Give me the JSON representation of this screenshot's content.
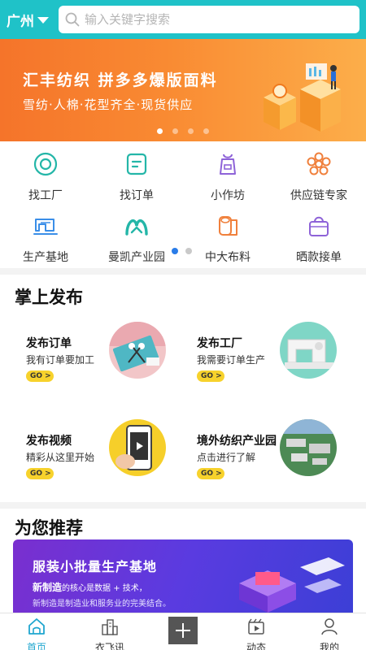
{
  "header": {
    "city": "广州",
    "search_placeholder": "输入关键字搜索"
  },
  "banner": {
    "title": "汇丰纺织  拼多多爆版面料",
    "subtitle": "雪纺·人棉·花型齐全·现货供应",
    "dots": 4,
    "active_dot": 0
  },
  "grid": [
    {
      "label": "找工厂",
      "icon": "factory-target-icon"
    },
    {
      "label": "找订单",
      "icon": "order-list-icon"
    },
    {
      "label": "小作坊",
      "icon": "apron-icon"
    },
    {
      "label": "供应链专家",
      "icon": "gear-flower-icon"
    },
    {
      "label": "生产基地",
      "icon": "sewing-machine-icon"
    },
    {
      "label": "曼凯产业园",
      "icon": "mk-logo-icon"
    },
    {
      "label": "中大布料",
      "icon": "fabric-roll-icon"
    },
    {
      "label": "晒款接单",
      "icon": "shopping-bag-icon"
    }
  ],
  "publish": {
    "title": "掌上发布",
    "cards": [
      {
        "title": "发布订单",
        "subtitle": "我有订单要加工",
        "go": "GO >"
      },
      {
        "title": "发布工厂",
        "subtitle": "我需要订单生产",
        "go": "GO >"
      },
      {
        "title": "发布视频",
        "subtitle": "精彩从这里开始",
        "go": "GO >"
      },
      {
        "title": "境外纺织产业园",
        "subtitle": "点击进行了解",
        "go": "GO >"
      }
    ]
  },
  "recommend": {
    "title": "为您推荐",
    "banner_title": "服装小批量生产基地",
    "banner_line1_bold": "新制造",
    "banner_line1_rest": "的核心是数据 + 技术，",
    "banner_line2": "新制造是制造业和服务业的完美结合。"
  },
  "tabs": [
    {
      "label": "首页",
      "icon": "home-icon",
      "active": true
    },
    {
      "label": "衣飞讯",
      "icon": "city-buildings-icon",
      "active": false
    },
    {
      "label": "",
      "icon": "plus-icon",
      "active": false
    },
    {
      "label": "动态",
      "icon": "video-clapper-icon",
      "active": false
    },
    {
      "label": "我的",
      "icon": "user-icon",
      "active": false
    }
  ],
  "colors": {
    "brand": "#1fc2c8",
    "banner_orange": "#f98a32",
    "go_yellow": "#f7d22c",
    "active_tab": "#1fa6cf",
    "recommend_purple": "#5a3be0"
  }
}
